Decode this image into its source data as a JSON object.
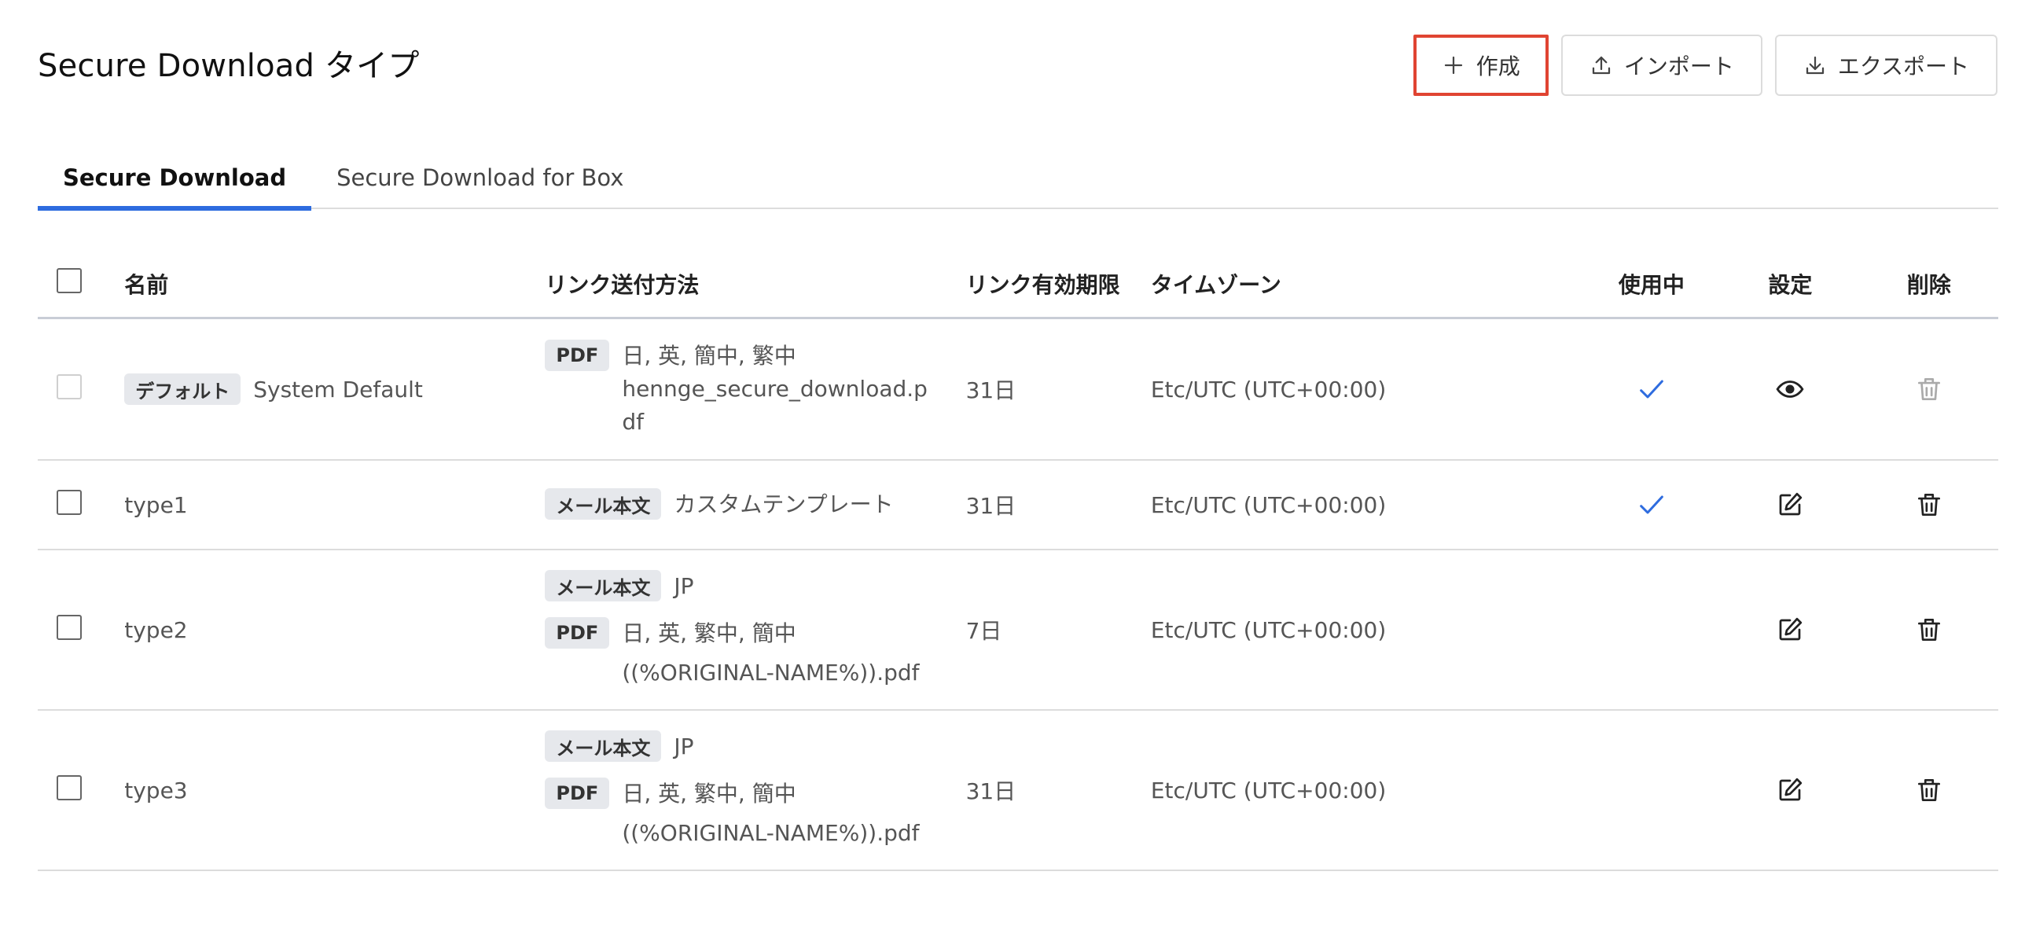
{
  "page": {
    "title": "Secure Download タイプ"
  },
  "toolbar": {
    "create_label": "作成",
    "import_label": "インポート",
    "export_label": "エクスポート"
  },
  "tabs": [
    {
      "label": "Secure Download",
      "active": true
    },
    {
      "label": "Secure Download for Box",
      "active": false
    }
  ],
  "table": {
    "headers": {
      "name": "名前",
      "method": "リンク送付方法",
      "expiry": "リンク有効期限",
      "timezone": "タイムゾーン",
      "in_use": "使用中",
      "settings": "設定",
      "delete": "削除"
    },
    "rows": [
      {
        "badge": "デフォルト",
        "name": "System Default",
        "methods": [
          {
            "tag": "PDF",
            "line1": "日, 英, 簡中, 繁中",
            "line2": "hennge_secure_download.p",
            "line3": "df"
          }
        ],
        "expiry": "31日",
        "timezone": "Etc/UTC (UTC+00:00)",
        "in_use": true,
        "settings_icon": "eye-icon",
        "delete_disabled": true
      },
      {
        "name": "type1",
        "methods": [
          {
            "tag": "メール本文",
            "line1": "カスタムテンプレート"
          }
        ],
        "expiry": "31日",
        "timezone": "Etc/UTC (UTC+00:00)",
        "in_use": true,
        "settings_icon": "edit-icon",
        "delete_disabled": false
      },
      {
        "name": "type2",
        "methods": [
          {
            "tag": "メール本文",
            "line1": "JP"
          },
          {
            "tag": "PDF",
            "line1": "日, 英, 繁中, 簡中",
            "line2": "((%ORIGINAL-NAME%)).pdf"
          }
        ],
        "expiry": "7日",
        "timezone": "Etc/UTC (UTC+00:00)",
        "in_use": false,
        "settings_icon": "edit-icon",
        "delete_disabled": false
      },
      {
        "name": "type3",
        "methods": [
          {
            "tag": "メール本文",
            "line1": "JP"
          },
          {
            "tag": "PDF",
            "line1": "日, 英, 繁中, 簡中",
            "line2": "((%ORIGINAL-NAME%)).pdf"
          }
        ],
        "expiry": "31日",
        "timezone": "Etc/UTC (UTC+00:00)",
        "in_use": false,
        "settings_icon": "edit-icon",
        "delete_disabled": false
      }
    ]
  },
  "colors": {
    "accent": "#2e6cdf",
    "create_highlight": "#e04432",
    "tag_bg": "#e6e8ec"
  }
}
